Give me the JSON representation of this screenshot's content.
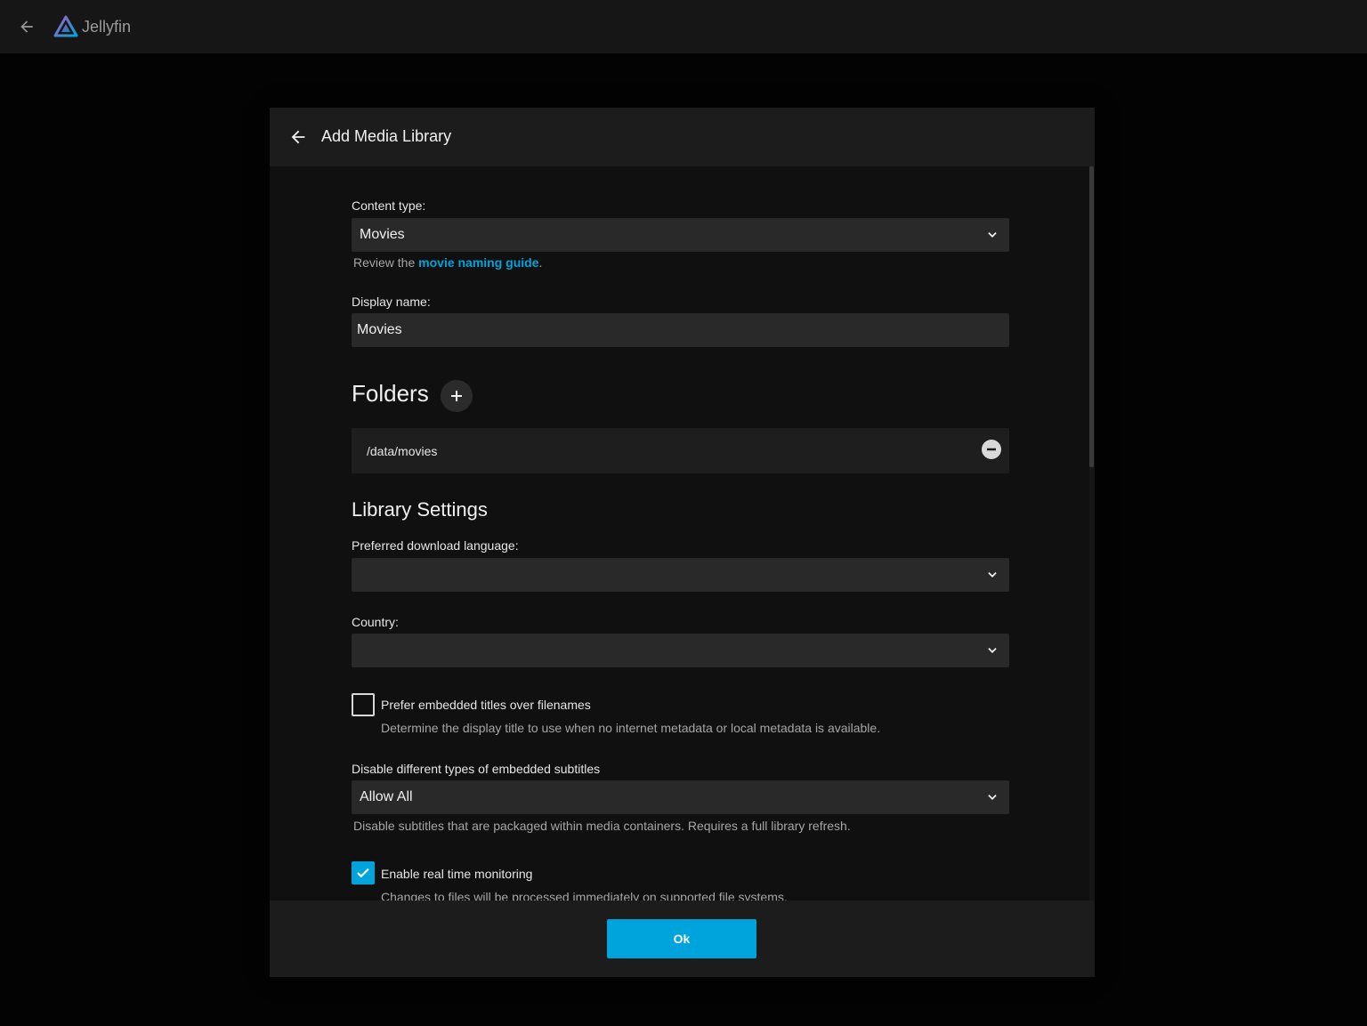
{
  "app": {
    "name": "Jellyfin"
  },
  "dialog": {
    "title": "Add Media Library",
    "ok_label": "Ok"
  },
  "content_type": {
    "label": "Content type:",
    "value": "Movies",
    "help_prefix": "Review the ",
    "help_link": "movie naming guide",
    "help_suffix": "."
  },
  "display_name": {
    "label": "Display name:",
    "value": "Movies"
  },
  "folders": {
    "title": "Folders",
    "items": [
      "/data/movies"
    ]
  },
  "library_settings": {
    "title": "Library Settings",
    "language": {
      "label": "Preferred download language:",
      "value": ""
    },
    "country": {
      "label": "Country:",
      "value": ""
    },
    "prefer_embedded": {
      "label": "Prefer embedded titles over filenames",
      "help": "Determine the display title to use when no internet metadata or local metadata is available.",
      "checked": false
    },
    "subtitles": {
      "label": "Disable different types of embedded subtitles",
      "value": "Allow All",
      "help": "Disable subtitles that are packaged within media containers. Requires a full library refresh."
    },
    "realtime": {
      "label": "Enable real time monitoring",
      "help": "Changes to files will be processed immediately on supported file systems.",
      "checked": true
    }
  },
  "colors": {
    "accent": "#00a4dc",
    "background": "#030303",
    "dialog": "#101010",
    "field": "#292929"
  }
}
